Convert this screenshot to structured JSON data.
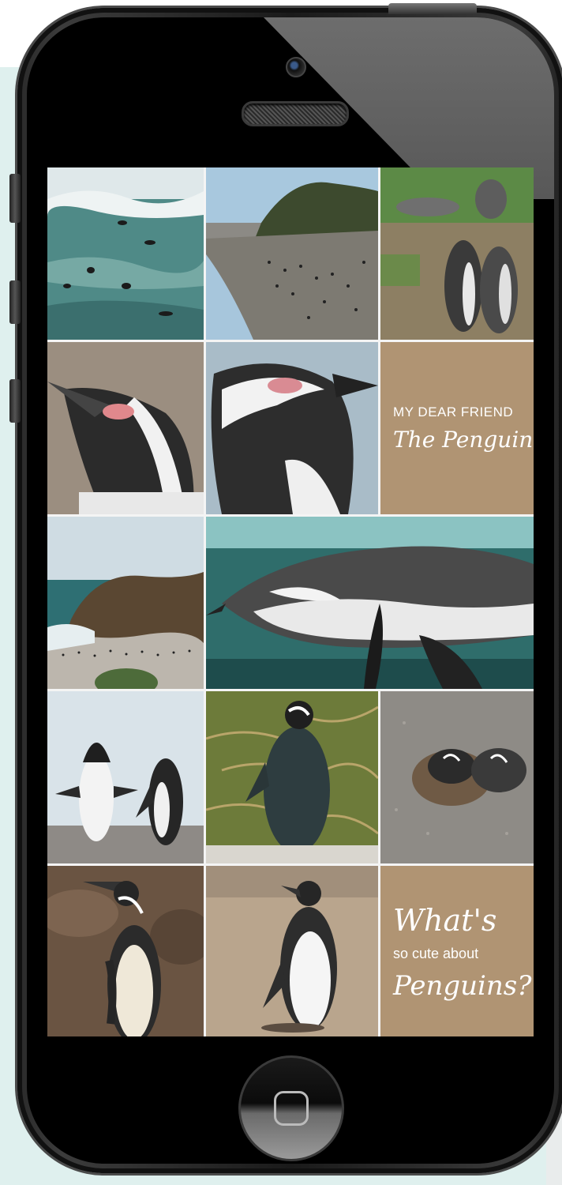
{
  "tiles": {
    "friend_line1": "MY DEAR FRIEND",
    "friend_line2": "The Penguin",
    "cute_line1": "What's",
    "cute_line2": "so cute about",
    "cute_line3": "Penguins?"
  },
  "colors": {
    "tile_tan": "#b09473",
    "background_teal": "#dff0ee",
    "phone_body": "#1a1a1a"
  },
  "icons": {
    "home": "home-square-icon",
    "camera": "front-camera-icon",
    "speaker": "speaker-grille-icon"
  }
}
